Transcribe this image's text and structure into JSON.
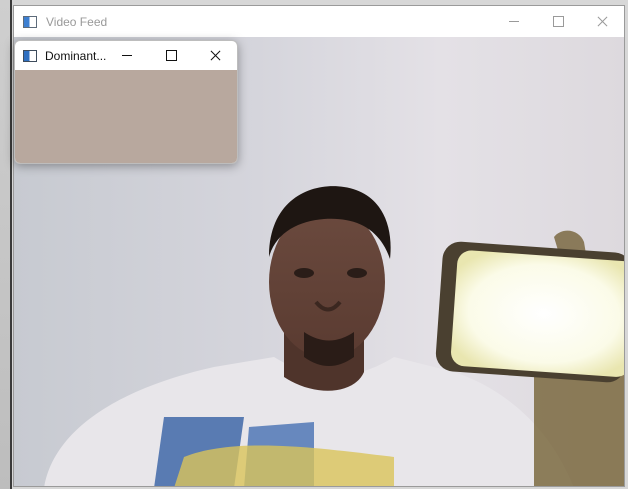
{
  "main_window": {
    "title": "Video Feed",
    "icon": "app-window-icon",
    "controls": [
      "minimize-icon",
      "maximize-icon",
      "close-icon"
    ]
  },
  "popup_window": {
    "title": "Dominant...",
    "icon": "app-window-icon",
    "controls": [
      "minimize-icon",
      "maximize-icon",
      "close-icon"
    ],
    "swatch_color": "#b8a89e"
  }
}
